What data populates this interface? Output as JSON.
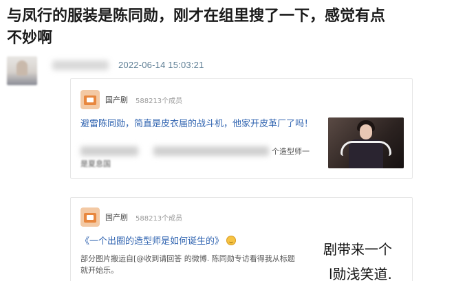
{
  "headline": {
    "line1": "与凤行的服装是陈同勋，刚才在组里搜了一下，感觉有点",
    "line2": "不妙啊"
  },
  "post": {
    "timestamp": "2022-06-14 15:03:21"
  },
  "cards": [
    {
      "group_name": "国产剧",
      "member_count": "588213个成员",
      "text": "避雷陈同勋，简直是皮衣届的战斗机，他家开皮革厂了吗！",
      "sub_right": "个造型师一",
      "sub_left": "是夏息国"
    },
    {
      "group_name": "国产剧",
      "member_count": "588213个成员",
      "title": "《一个出圈的造型师是如何诞生的》",
      "sub_line1": "部分图片搬运自[@收到请回答 的微博. 陈同勋专访看得我从标题",
      "sub_line2": "就开始乐。"
    }
  ],
  "overlay_subtitles": {
    "line1": "剧带来一个",
    "line2": "l勋浅笑道."
  },
  "icons": {
    "emoji": "smile-icon"
  }
}
